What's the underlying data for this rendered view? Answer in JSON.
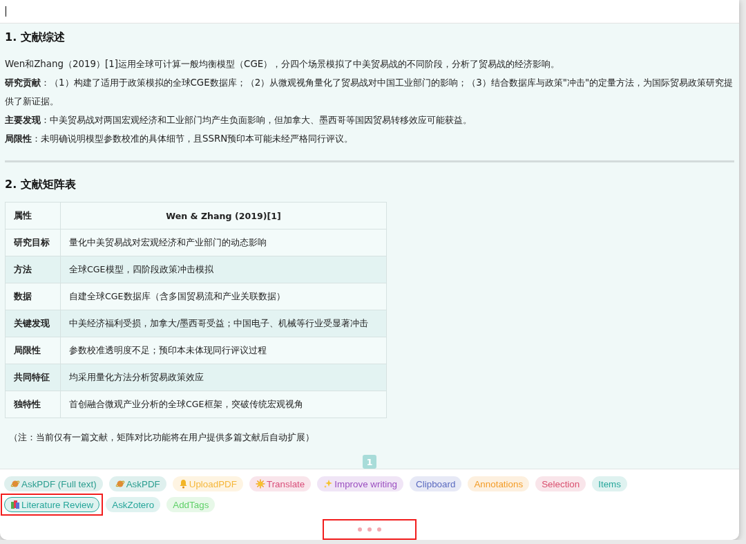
{
  "input": {
    "focused": true
  },
  "sections": [
    {
      "kind": "text",
      "heading": "1. 文献综述",
      "paragraphs": [
        "Wen和Zhang（2019）[1]运用全球可计算一般均衡模型（CGE），分四个场景模拟了中美贸易战的不同阶段，分析了贸易战的经济影响。",
        "**研究贡献**：（1）构建了适用于政策模拟的全球CGE数据库；（2）从微观视角量化了贸易战对中国工业部门的影响；（3）结合数据库与政策\"冲击\"的定量方法，为国际贸易政策研究提供了新证据。",
        "**主要发现**：中美贸易战对两国宏观经济和工业部门均产生负面影响，但加拿大、墨西哥等国因贸易转移效应可能获益。",
        "**局限性**：未明确说明模型参数校准的具体细节，且SSRN预印本可能未经严格同行评议。"
      ]
    },
    {
      "kind": "table",
      "heading": "2. 文献矩阵表",
      "columns": [
        "属性",
        "Wen & Zhang (2019)[1]"
      ],
      "rows": [
        [
          "研究目标",
          "量化中美贸易战对宏观经济和产业部门的动态影响"
        ],
        [
          "方法",
          "全球CGE模型，四阶段政策冲击模拟"
        ],
        [
          "数据",
          "自建全球CGE数据库（含多国贸易流和产业关联数据）"
        ],
        [
          "关键发现",
          "中美经济福利受损，加拿大/墨西哥受益；中国电子、机械等行业受显著冲击"
        ],
        [
          "局限性",
          "参数校准透明度不足；预印本未体现同行评议过程"
        ],
        [
          "共同特征",
          "均采用量化方法分析贸易政策效应"
        ],
        [
          "独特性",
          "首创融合微观产业分析的全球CGE框架，突破传统宏观视角"
        ]
      ],
      "note": "（注：当前仅有一篇文献，矩阵对比功能将在用户提供多篇文献后自动扩展）"
    }
  ],
  "pagination": [
    {
      "label": "1",
      "selected": true
    }
  ],
  "tags": [
    {
      "label": "AskPDF (Full text)",
      "color": "#2a9d8f",
      "selected": false,
      "highlighted": false
    },
    {
      "label": "AskPDF",
      "color": "#2a9d8f",
      "selected": false,
      "highlighted": false
    },
    {
      "label": "UploadPDF",
      "color": "#f5b73b",
      "selected": false,
      "highlighted": false
    },
    {
      "label": "Translate",
      "color": "#d94f7a",
      "selected": false,
      "highlighted": false
    },
    {
      "label": "Improve writing",
      "color": "#9b4fc0",
      "selected": false,
      "highlighted": false
    },
    {
      "label": "Clipboard",
      "color": "#5c6bc0",
      "selected": false,
      "highlighted": false
    },
    {
      "label": "Annotations",
      "color": "#f39c27",
      "selected": false,
      "highlighted": false
    },
    {
      "label": "Selection",
      "color": "#d9506f",
      "selected": false,
      "highlighted": false
    },
    {
      "label": "Items",
      "color": "#26a69a",
      "selected": false,
      "highlighted": false
    },
    {
      "label": "Literature Review",
      "color": "#26a69a",
      "selected": true,
      "highlighted": true
    },
    {
      "label": "AskZotero",
      "color": "#26a69a",
      "selected": false,
      "highlighted": false
    },
    {
      "label": "AddTags",
      "color": "#5fd068",
      "selected": false,
      "highlighted": false
    }
  ],
  "more_menu": {
    "highlighted": true
  }
}
